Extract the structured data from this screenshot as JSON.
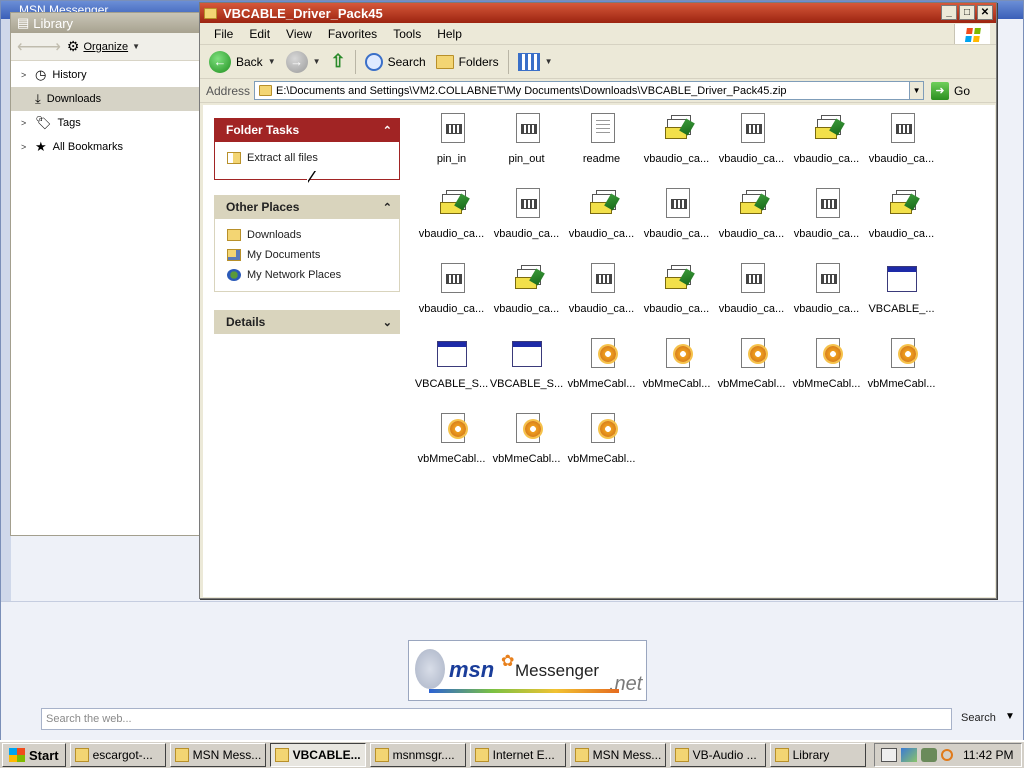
{
  "msn": {
    "title": "MSN Messenger",
    "logo_brand": "msn",
    "logo_product": "Messenger",
    "logo_net": ".net",
    "search_placeholder": "Search the web...",
    "search_button": "Search"
  },
  "library": {
    "title": "Library",
    "organize_label": "Organize",
    "items": [
      {
        "label": "History",
        "icon": "clock-icon",
        "expandable": true,
        "selected": false
      },
      {
        "label": "Downloads",
        "icon": "download-icon",
        "expandable": false,
        "selected": true
      },
      {
        "label": "Tags",
        "icon": "tag-icon",
        "expandable": true,
        "selected": false
      },
      {
        "label": "All Bookmarks",
        "icon": "star-icon",
        "expandable": true,
        "selected": false
      }
    ]
  },
  "explorer": {
    "title": "VBCABLE_Driver_Pack45",
    "menu": [
      "File",
      "Edit",
      "View",
      "Favorites",
      "Tools",
      "Help"
    ],
    "toolbar": {
      "back_label": "Back",
      "search_label": "Search",
      "folders_label": "Folders"
    },
    "address_label": "Address",
    "address_value": "E:\\Documents and Settings\\VM2.COLLABNET\\My Documents\\Downloads\\VBCABLE_Driver_Pack45.zip",
    "go_label": "Go",
    "folder_tasks": {
      "title": "Folder Tasks",
      "items": [
        "Extract all files"
      ]
    },
    "other_places": {
      "title": "Other Places",
      "items": [
        "Downloads",
        "My Documents",
        "My Network Places"
      ]
    },
    "details": {
      "title": "Details"
    },
    "files": [
      {
        "name": "pin_in",
        "type": "doc"
      },
      {
        "name": "pin_out",
        "type": "doc"
      },
      {
        "name": "readme",
        "type": "txt"
      },
      {
        "name": "vbaudio_ca...",
        "type": "cfg"
      },
      {
        "name": "vbaudio_ca...",
        "type": "doc"
      },
      {
        "name": "vbaudio_ca...",
        "type": "cfg"
      },
      {
        "name": "vbaudio_ca...",
        "type": "doc"
      },
      {
        "name": "vbaudio_ca...",
        "type": "cfg"
      },
      {
        "name": "vbaudio_ca...",
        "type": "doc"
      },
      {
        "name": "vbaudio_ca...",
        "type": "cfg"
      },
      {
        "name": "vbaudio_ca...",
        "type": "doc"
      },
      {
        "name": "vbaudio_ca...",
        "type": "cfg"
      },
      {
        "name": "vbaudio_ca...",
        "type": "doc"
      },
      {
        "name": "vbaudio_ca...",
        "type": "cfg"
      },
      {
        "name": "vbaudio_ca...",
        "type": "doc"
      },
      {
        "name": "vbaudio_ca...",
        "type": "cfg"
      },
      {
        "name": "vbaudio_ca...",
        "type": "doc"
      },
      {
        "name": "vbaudio_ca...",
        "type": "cfg"
      },
      {
        "name": "vbaudio_ca...",
        "type": "doc"
      },
      {
        "name": "vbaudio_ca...",
        "type": "doc"
      },
      {
        "name": "VBCABLE_...",
        "type": "exe"
      },
      {
        "name": "VBCABLE_S...",
        "type": "exe"
      },
      {
        "name": "VBCABLE_S...",
        "type": "exe"
      },
      {
        "name": "vbMmeCabl...",
        "type": "inf"
      },
      {
        "name": "vbMmeCabl...",
        "type": "inf"
      },
      {
        "name": "vbMmeCabl...",
        "type": "inf"
      },
      {
        "name": "vbMmeCabl...",
        "type": "inf"
      },
      {
        "name": "vbMmeCabl...",
        "type": "inf"
      },
      {
        "name": "vbMmeCabl...",
        "type": "inf"
      },
      {
        "name": "vbMmeCabl...",
        "type": "inf"
      },
      {
        "name": "vbMmeCabl...",
        "type": "inf"
      }
    ]
  },
  "taskbar": {
    "start_label": "Start",
    "buttons": [
      {
        "label": "escargot-...",
        "active": false
      },
      {
        "label": "MSN Mess...",
        "active": false
      },
      {
        "label": "VBCABLE...",
        "active": true
      },
      {
        "label": "msnmsgr....",
        "active": false
      },
      {
        "label": "Internet E...",
        "active": false
      },
      {
        "label": "MSN Mess...",
        "active": false
      },
      {
        "label": "VB-Audio ...",
        "active": false
      },
      {
        "label": "Library",
        "active": false
      }
    ],
    "clock": "11:42 PM"
  },
  "colors": {
    "explorer_title": "#9c2410",
    "task_header_red": "#a12424",
    "task_header_tan": "#d9d4bd",
    "taskbar_bg": "#d4d0c8"
  }
}
